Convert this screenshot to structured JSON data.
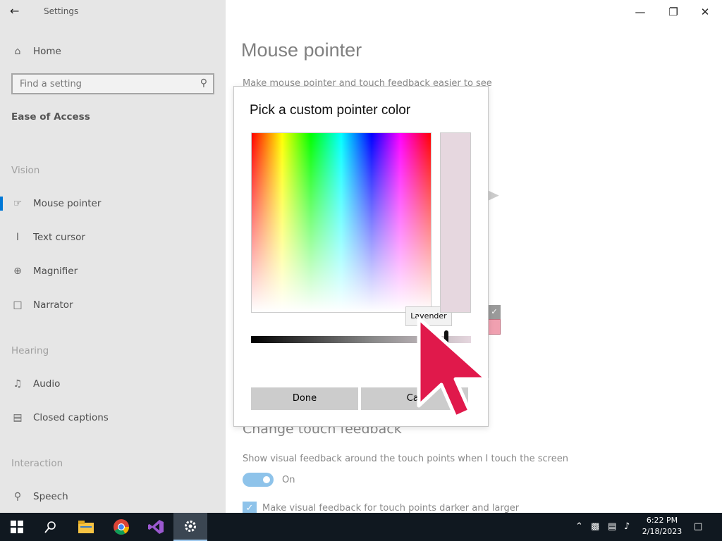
{
  "app": {
    "title": "Settings"
  },
  "nav": {
    "home": "Home",
    "search_placeholder": "Find a setting",
    "section": "Ease of Access",
    "groups": [
      {
        "header": "Vision",
        "items": [
          "Mouse pointer",
          "Text cursor",
          "Magnifier",
          "Narrator"
        ]
      },
      {
        "header": "Hearing",
        "items": [
          "Audio",
          "Closed captions"
        ]
      },
      {
        "header": "Interaction",
        "items": [
          "Speech"
        ]
      }
    ],
    "selected": "Mouse pointer"
  },
  "main": {
    "title": "Mouse pointer",
    "subtitle": "Make mouse pointer and touch feedback easier to see",
    "touch_heading": "Change touch feedback",
    "touch_desc": "Show visual feedback around the touch points when I touch the screen",
    "toggle_state": "On",
    "checkbox_label": "Make visual feedback for touch points darker and larger"
  },
  "dialog": {
    "title": "Pick a custom pointer color",
    "tooltip": "Lavender",
    "preview_color": "#e6d7df",
    "done_label": "Done",
    "cancel_label": "Car"
  },
  "taskbar": {
    "time": "6:22 PM",
    "date": "2/18/2023",
    "icons": [
      "windows-start-icon",
      "search-icon",
      "file-explorer-icon",
      "chrome-icon",
      "visual-studio-icon",
      "settings-gear-icon"
    ]
  },
  "colors": {
    "accent": "#0078d7",
    "pointer": "#e0194b",
    "toggle": "#8ec3ea"
  }
}
